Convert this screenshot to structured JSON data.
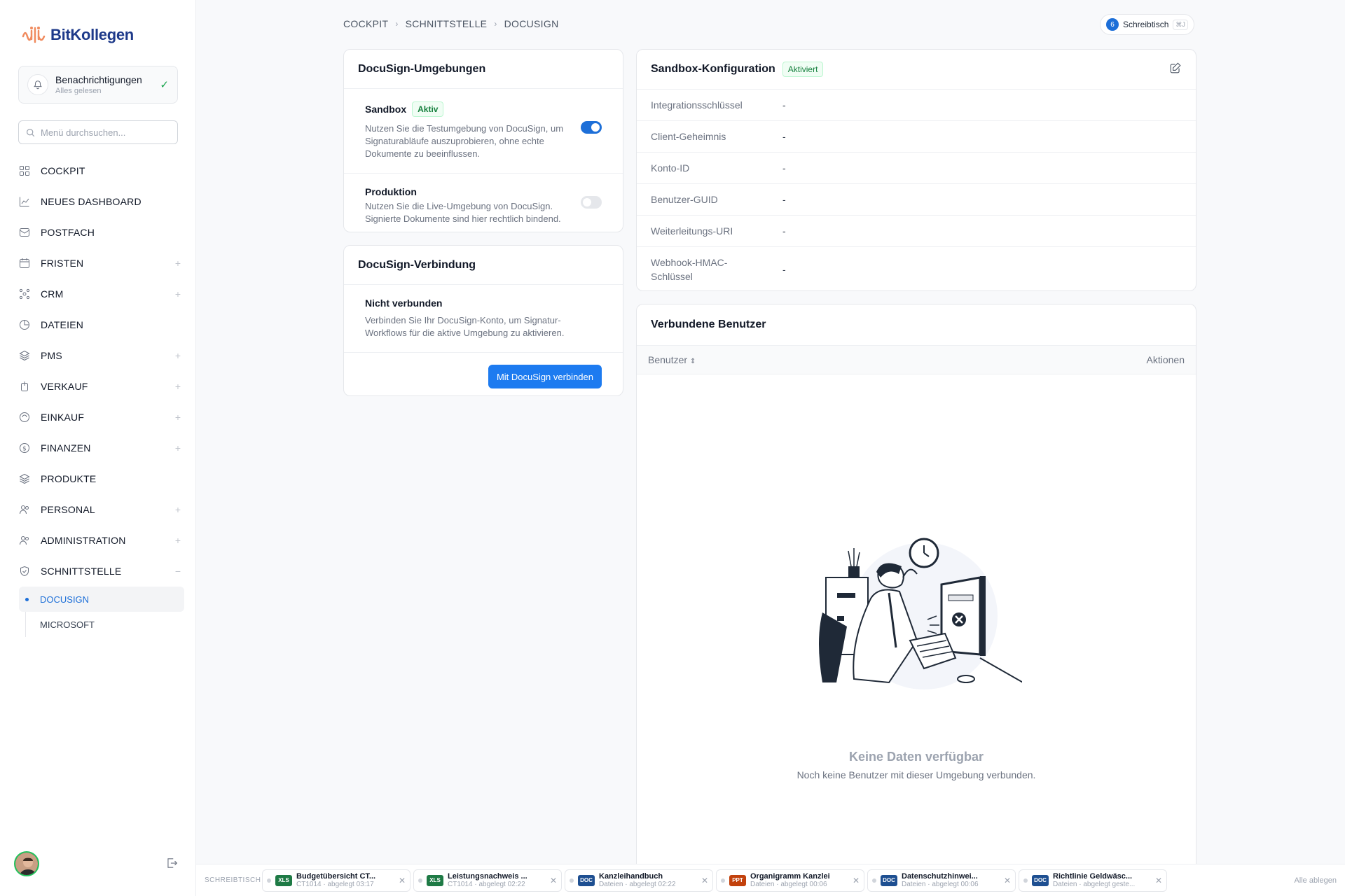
{
  "brand": {
    "name": "BitKollegen"
  },
  "notifications": {
    "title": "Benachrichtigungen",
    "subtitle": "Alles gelesen"
  },
  "search": {
    "placeholder": "Menü durchsuchen..."
  },
  "nav": {
    "items": [
      {
        "label": "COCKPIT",
        "icon": "grid-icon",
        "expandable": false
      },
      {
        "label": "NEUES DASHBOARD",
        "icon": "chart-line-icon",
        "expandable": false
      },
      {
        "label": "POSTFACH",
        "icon": "inbox-icon",
        "expandable": false
      },
      {
        "label": "FRISTEN",
        "icon": "calendar-icon",
        "expandable": true
      },
      {
        "label": "CRM",
        "icon": "users-network-icon",
        "expandable": true
      },
      {
        "label": "DATEIEN",
        "icon": "folder-icon",
        "expandable": false
      },
      {
        "label": "PMS",
        "icon": "layers-icon",
        "expandable": true
      },
      {
        "label": "VERKAUF",
        "icon": "tag-icon",
        "expandable": true
      },
      {
        "label": "EINKAUF",
        "icon": "cart-icon",
        "expandable": true
      },
      {
        "label": "FINANZEN",
        "icon": "coin-icon",
        "expandable": true
      },
      {
        "label": "PRODUKTE",
        "icon": "box-icon",
        "expandable": false
      },
      {
        "label": "PERSONAL",
        "icon": "person-icon",
        "expandable": true
      },
      {
        "label": "ADMINISTRATION",
        "icon": "admin-icon",
        "expandable": true
      },
      {
        "label": "SCHNITTSTELLE",
        "icon": "shield-icon",
        "expandable": true,
        "expanded": true
      }
    ],
    "sub_items": [
      {
        "label": "DOCUSIGN",
        "active": true
      },
      {
        "label": "MICROSOFT",
        "active": false
      }
    ]
  },
  "breadcrumb": [
    "COCKPIT",
    "SCHNITTSTELLE",
    "DOCUSIGN"
  ],
  "desk": {
    "count": "6",
    "label": "Schreibtisch",
    "shortcut": "⌘J"
  },
  "environments": {
    "title": "DocuSign-Umgebungen",
    "items": [
      {
        "name": "Sandbox",
        "badge": "Aktiv",
        "description": "Nutzen Sie die Testumgebung von DocuSign, um Signaturabläufe auszuprobieren, ohne echte Dokumente zu beeinflussen.",
        "enabled": true
      },
      {
        "name": "Produktion",
        "badge": "",
        "description": "Nutzen Sie die Live-Umgebung von DocuSign. Signierte Dokumente sind hier rechtlich bindend.",
        "enabled": false
      }
    ]
  },
  "connection": {
    "title": "DocuSign-Verbindung",
    "status": "Nicht verbunden",
    "description": "Verbinden Sie Ihr DocuSign-Konto, um Signatur-Workflows für die aktive Umgebung zu aktivieren.",
    "button": "Mit DocuSign verbinden"
  },
  "config": {
    "title": "Sandbox-Konfiguration",
    "badge": "Aktiviert",
    "rows": [
      {
        "key": "Integrationsschlüssel",
        "value": "-"
      },
      {
        "key": "Client-Geheimnis",
        "value": "-"
      },
      {
        "key": "Konto-ID",
        "value": "-"
      },
      {
        "key": "Benutzer-GUID",
        "value": "-"
      },
      {
        "key": "Weiterleitungs-URI",
        "value": "-"
      },
      {
        "key": "Webhook-HMAC-Schlüssel",
        "value": "-"
      }
    ]
  },
  "users": {
    "title": "Verbundene Benutzer",
    "columns": {
      "user": "Benutzer",
      "actions": "Aktionen"
    },
    "empty_title": "Keine Daten verfügbar",
    "empty_subtitle": "Noch keine Benutzer mit dieser Umgebung verbunden."
  },
  "tray": {
    "label": "SCHREIBTISCH",
    "clear_all": "Alle ablegen",
    "items": [
      {
        "type": "XLS",
        "color": "#1e7a45",
        "name": "Budgetübersicht CT...",
        "meta": "CT1014 · abgelegt 03:17"
      },
      {
        "type": "XLS",
        "color": "#1e7a45",
        "name": "Leistungsnachweis ...",
        "meta": "CT1014 · abgelegt 02:22"
      },
      {
        "type": "DOC",
        "color": "#1e4f91",
        "name": "Kanzleihandbuch",
        "meta": "Dateien · abgelegt 02:22"
      },
      {
        "type": "PPT",
        "color": "#c2410c",
        "name": "Organigramm Kanzlei",
        "meta": "Dateien · abgelegt 00:06"
      },
      {
        "type": "DOC",
        "color": "#1e4f91",
        "name": "Datenschutzhinwei...",
        "meta": "Dateien · abgelegt 00:06"
      },
      {
        "type": "DOC",
        "color": "#1e4f91",
        "name": "Richtlinie Geldwäsc...",
        "meta": "Dateien · abgelegt geste..."
      }
    ]
  },
  "colors": {
    "accent": "#1d7bf0",
    "success": "#15803d",
    "brand_orange": "#f08a5d"
  }
}
